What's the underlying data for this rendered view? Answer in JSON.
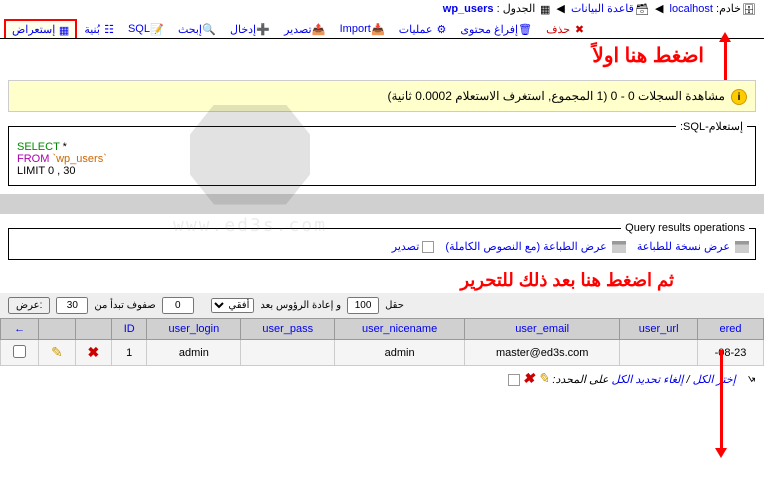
{
  "breadcrumb": {
    "server_label": "خادم:",
    "server": "localhost",
    "db": "قاعدة البيانات",
    "table_label": "الجدول :",
    "table": "wp_users"
  },
  "tabs": {
    "browse": "إستعراض",
    "structure": "بُنية",
    "sql": "SQL",
    "search": "إبحث",
    "insert": "إدخال",
    "export": "تصدير",
    "import": "Import",
    "operations": "عمليات",
    "empty": "إفراغ محتوى",
    "drop": "حذف"
  },
  "annotations": {
    "first": "اضغط هنا اولاً",
    "second": "ثم اضغط هنا بعد ذلك للتحرير"
  },
  "query_info": "مشاهدة السجلات 0 - 0 (1 المجموع, استغرف الاستعلام 0.0002 ثانية)",
  "sql": {
    "legend": "إستعلام-SQL:",
    "select_kw": "SELECT",
    "star": "*",
    "from_kw": "FROM",
    "table": "`wp_users`",
    "limit": "LIMIT 0 , 30"
  },
  "watermark": "www.ed3s.com",
  "query_ops": {
    "legend": "Query results operations",
    "print": "عرض نسخة للطباعة",
    "print_full": "عرض الطباعة (مع النصوص الكاملة)",
    "export": "تصدير"
  },
  "nav": {
    "show_btn": ":عرض",
    "rows_value": "30",
    "rows_label": "صفوف تبدأ من",
    "start_value": "0",
    "mode": "أفقي",
    "repeat_label": "و إعادة الرؤوس بعد",
    "repeat_value": "100",
    "cells_label": "حقل"
  },
  "table": {
    "cols": {
      "id": "ID",
      "login": "user_login",
      "pass": "user_pass",
      "nicename": "user_nicename",
      "email": "user_email",
      "url": "user_url",
      "registered": "ered"
    },
    "row": {
      "id": "1",
      "login": "admin",
      "nicename": "admin",
      "email": "master@ed3s.com",
      "url": "",
      "registered": "-08-23"
    }
  },
  "select_all": {
    "check_all": "إختر الكل",
    "uncheck_all": "إلغاء تحديد الكل",
    "with_selected": "على المحدد:"
  }
}
